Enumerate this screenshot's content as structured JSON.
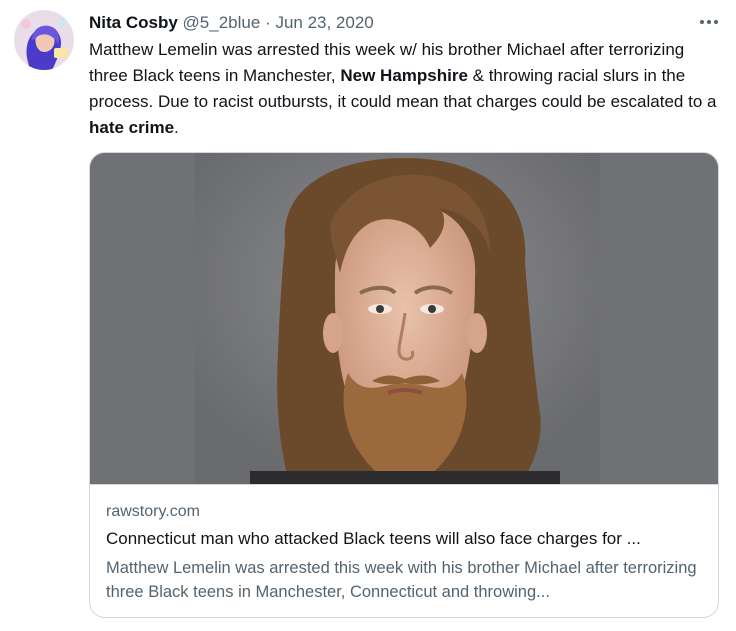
{
  "tweet": {
    "author_name": "Nita Cosby",
    "handle": "@5_2blue",
    "separator": "·",
    "date": "Jun 23, 2020",
    "text_segments": [
      {
        "text": "Matthew Lemelin was arrested this week w/ his brother Michael after terrorizing three Black teens in Manchester, ",
        "bold": false
      },
      {
        "text": "New Hampshire",
        "bold": true
      },
      {
        "text": " & throwing racial slurs in the process. Due to racist outbursts, it could mean that charges could be escalated to a ",
        "bold": false
      },
      {
        "text": "hate crime",
        "bold": true
      },
      {
        "text": ".",
        "bold": false
      }
    ],
    "more_icon": "more-horizontal-icon"
  },
  "card": {
    "domain": "rawstory.com",
    "title": "Connecticut man who attacked Black teens will also face charges for ...",
    "description": "Matthew Lemelin was arrested this week with his brother Michael after terrorizing three Black teens in Manchester, Connecticut and throwing...",
    "image": "mugshot-photo"
  },
  "colors": {
    "text_primary": "#0f1419",
    "text_secondary": "#536471",
    "border": "#cfd9de",
    "avatar_bg": "#e8dce8",
    "avatar_figure": "#4a3cc9"
  }
}
